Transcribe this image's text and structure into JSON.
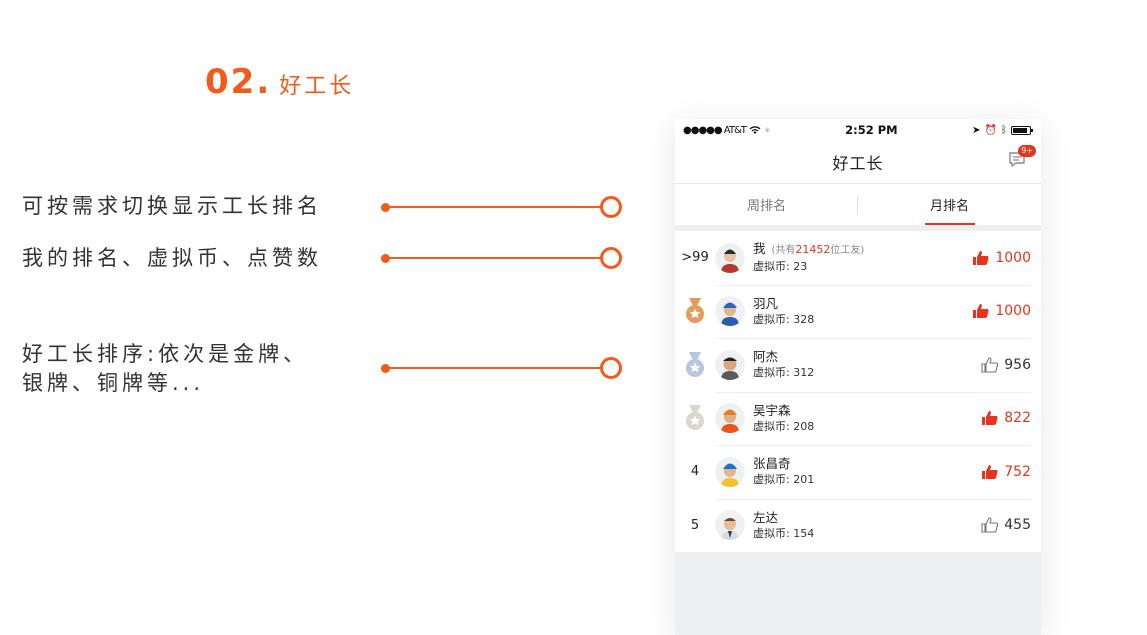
{
  "heading": {
    "number": "02.",
    "title": "好工长"
  },
  "callouts": [
    "可按需求切换显示工长排名",
    "我的排名、虚拟币、点赞数",
    "好工长排序:依次是金牌、",
    "银牌、铜牌等..."
  ],
  "colors": {
    "accent": "#f35a1b",
    "like_active": "#e8341c",
    "gold": "#e69a5c",
    "silver": "#b7c6dd",
    "bronze": "#d8d8cc"
  },
  "status_bar": {
    "carrier": "●●●●● AT&T",
    "time": "2:52 PM"
  },
  "nav": {
    "title": "好工长",
    "badge": "9+"
  },
  "tabs": [
    {
      "label": "周排名",
      "active": false
    },
    {
      "label": "月排名",
      "active": true
    }
  ],
  "coins_label": "虚拟币:",
  "me": {
    "rank": ">99",
    "name": "我",
    "sub_prefix": "(共有",
    "total": "21452",
    "sub_suffix": "位工友)",
    "coins": "23",
    "likes": "1000",
    "liked": true
  },
  "rows": [
    {
      "medal": "gold",
      "name": "羽凡",
      "coins": "328",
      "likes": "1000",
      "liked": true
    },
    {
      "medal": "silver",
      "name": "阿杰",
      "coins": "312",
      "likes": "956",
      "liked": false
    },
    {
      "medal": "bronze",
      "name": "吴宇森",
      "coins": "208",
      "likes": "822",
      "liked": true
    },
    {
      "rank": "4",
      "name": "张昌奇",
      "coins": "201",
      "likes": "752",
      "liked": true
    },
    {
      "rank": "5",
      "name": "左达",
      "coins": "154",
      "likes": "455",
      "liked": false
    }
  ]
}
